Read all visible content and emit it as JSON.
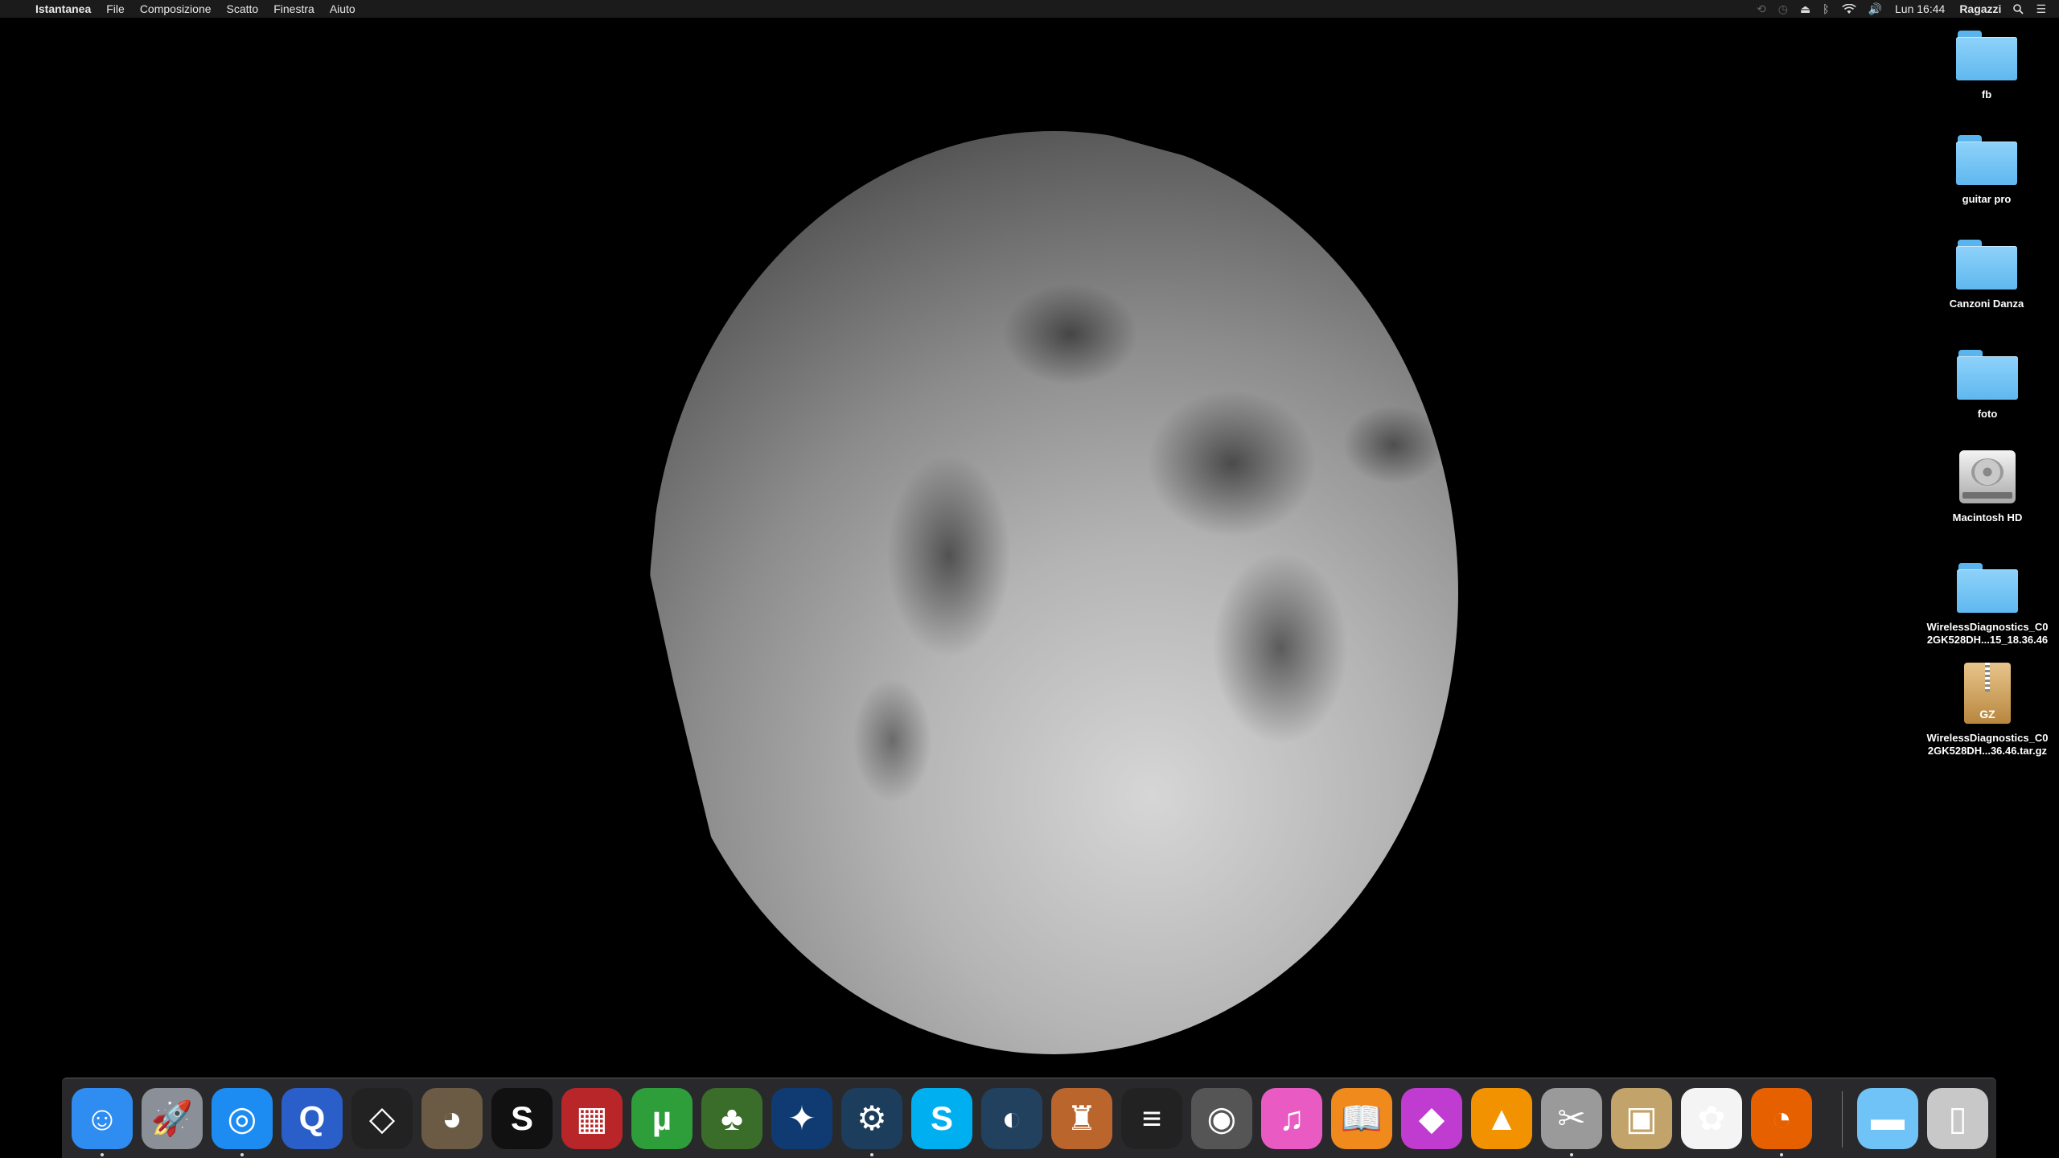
{
  "menubar": {
    "apple_glyph": "",
    "app_name": "Istantanea",
    "menus": [
      "File",
      "Composizione",
      "Scatto",
      "Finestra",
      "Aiuto"
    ],
    "clock": "Lun 16:44",
    "user": "Ragazzi"
  },
  "desktop_icons": [
    {
      "label": "fb",
      "type": "folder"
    },
    {
      "label": "guitar pro",
      "type": "folder"
    },
    {
      "label": "Canzoni Danza",
      "type": "folder"
    },
    {
      "label": "foto",
      "type": "folder"
    },
    {
      "label": "Macintosh HD",
      "type": "disk"
    },
    {
      "label": "WirelessDiagnostics_C0\n2GK528DH...15_18.36.46",
      "type": "folder"
    },
    {
      "label": "WirelessDiagnostics_C0\n2GK528DH...36.46.tar.gz",
      "type": "archive",
      "badge": "GZ"
    }
  ],
  "dock": {
    "apps": [
      {
        "name": "finder-icon",
        "glyph": "☺",
        "color": "#2f8cf0",
        "running": true
      },
      {
        "name": "launchpad-icon",
        "glyph": "🚀",
        "color": "#8a8f98",
        "running": false
      },
      {
        "name": "safari-icon",
        "glyph": "◎",
        "color": "#1d8cf2",
        "running": true
      },
      {
        "name": "quicktime-icon",
        "glyph": "Q",
        "color": "#2a5ec8",
        "running": false
      },
      {
        "name": "unity-icon",
        "glyph": "◇",
        "color": "#222",
        "running": false
      },
      {
        "name": "gimp-icon",
        "glyph": "◕",
        "color": "#6b5b45",
        "running": false
      },
      {
        "name": "spotlight-s-icon",
        "glyph": "S",
        "color": "#111",
        "running": false
      },
      {
        "name": "photo-booth-icon",
        "glyph": "▦",
        "color": "#b8262a",
        "running": false
      },
      {
        "name": "utorrent-icon",
        "glyph": "µ",
        "color": "#2e9e3a",
        "running": false
      },
      {
        "name": "terraria-tree-icon",
        "glyph": "♣",
        "color": "#3a6d2a",
        "running": false
      },
      {
        "name": "battle-net-icon",
        "glyph": "✦",
        "color": "#0f3b72",
        "running": false
      },
      {
        "name": "steam-icon",
        "glyph": "⚙",
        "color": "#1c3d5c",
        "running": true
      },
      {
        "name": "skype-icon",
        "glyph": "S",
        "color": "#00aff0",
        "running": false
      },
      {
        "name": "teamspeak-icon",
        "glyph": "◐",
        "color": "#22415e",
        "running": false
      },
      {
        "name": "game-badge-icon",
        "glyph": "♜",
        "color": "#b9652c",
        "running": false
      },
      {
        "name": "elgato-icon",
        "glyph": "≡",
        "color": "#222",
        "running": false
      },
      {
        "name": "disk-utility-icon",
        "glyph": "◉",
        "color": "#555",
        "running": false
      },
      {
        "name": "itunes-icon",
        "glyph": "♫",
        "color": "#e95bc3",
        "running": false
      },
      {
        "name": "ibooks-icon",
        "glyph": "📖",
        "color": "#f08a1c",
        "running": false
      },
      {
        "name": "colorsync-icon",
        "glyph": "◆",
        "color": "#c03bd0",
        "running": false
      },
      {
        "name": "vlc-icon",
        "glyph": "▲",
        "color": "#f29200",
        "running": false
      },
      {
        "name": "grab-scissors-icon",
        "glyph": "✂",
        "color": "#9a9a9a",
        "running": true
      },
      {
        "name": "preview-icon",
        "glyph": "▣",
        "color": "#c2a46a",
        "running": false
      },
      {
        "name": "photos-icon",
        "glyph": "✿",
        "color": "#f4f4f4",
        "running": false
      },
      {
        "name": "firefox-icon",
        "glyph": "◔",
        "color": "#e66000",
        "running": true
      }
    ],
    "stacks": [
      {
        "name": "downloads-folder-icon",
        "glyph": "▬",
        "color": "#6fc3f6"
      },
      {
        "name": "trash-icon",
        "glyph": "▯",
        "color": "#c8c8c8"
      }
    ]
  }
}
